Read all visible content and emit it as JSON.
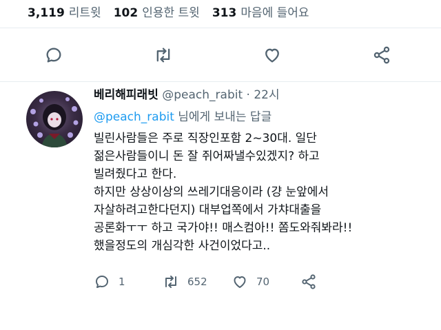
{
  "stats": [
    {
      "count": "3,119",
      "label": "리트윗"
    },
    {
      "count": "102",
      "label": "인용한 트윗"
    },
    {
      "count": "313",
      "label": "마음에 들어요"
    }
  ],
  "main_actions": {
    "icons": [
      "reply-icon",
      "retweet-icon",
      "like-icon",
      "share-icon"
    ]
  },
  "reply": {
    "display_name": "베리해피래빗",
    "handle": "@peach_rabit",
    "separator": "·",
    "time": "22시",
    "replying_to_mention": "@peach_rabit",
    "replying_to_suffix": " 님에게 보내는 답글",
    "lines": [
      "빌린사람들은 주로 직장인포함 2~30대. 일단",
      "젊은사람들이니 돈 잘 쥐어짜낼수있겠지? 하고",
      "빌려줬다고 한다.",
      "하지만 상상이상의 쓰레기대응이라 (걍 눈앞에서",
      "자살하려고한다던지) 대부업쪽에서 가챠대출을",
      "공론화ㅜㅜ 하고 국가야!! 매스컴아!! 쫌도와줘봐라!!",
      "했을정도의 개심각한 사건이었다고.."
    ],
    "reply_count": "1",
    "retweet_count": "652",
    "like_count": "70"
  }
}
